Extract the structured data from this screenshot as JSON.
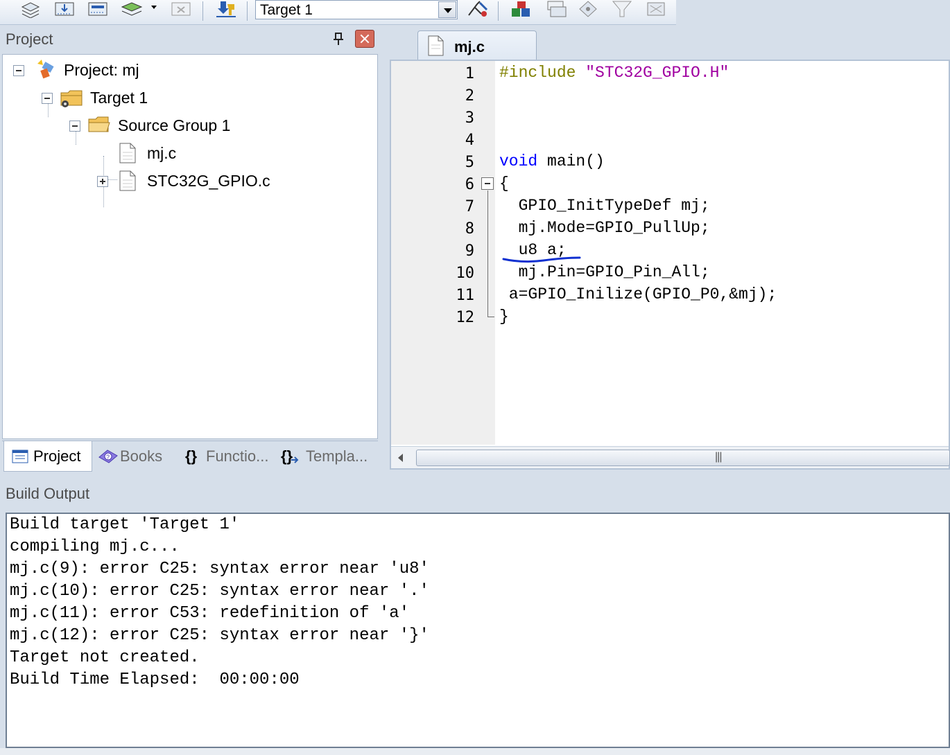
{
  "toolbar": {
    "target_select_value": "Target 1"
  },
  "project_panel": {
    "title": "Project",
    "tree": {
      "project": "Project: mj",
      "target": "Target 1",
      "group": "Source Group 1",
      "files": [
        "mj.c",
        "STC32G_GPIO.c"
      ]
    },
    "tabs": [
      "Project",
      "Books",
      "Functio...",
      "Templa..."
    ]
  },
  "editor": {
    "tab_label": "mj.c",
    "line_numbers": [
      "1",
      "2",
      "3",
      "4",
      "5",
      "6",
      "7",
      "8",
      "9",
      "10",
      "11",
      "12"
    ],
    "code": {
      "l1_directive": "#include",
      "l1_string": "\"STC32G_GPIO.H\"",
      "l5_keyword": "void",
      "l5_rest": " main()",
      "l6": "{",
      "l7": "  GPIO_InitTypeDef mj;",
      "l8": "  mj.Mode=GPIO_PullUp;",
      "l9": "  u8 a;",
      "l10": "  mj.Pin=GPIO_Pin_All;",
      "l11": " a=GPIO_Inilize(GPIO_P0,&mj);",
      "l12": "}"
    },
    "annotation_color": "#1030d0"
  },
  "build_output": {
    "title": "Build Output",
    "lines": [
      "Build target 'Target 1'",
      "compiling mj.c...",
      "mj.c(9): error C25: syntax error near 'u8'",
      "mj.c(10): error C25: syntax error near '.'",
      "mj.c(11): error C53: redefinition of 'a'",
      "mj.c(12): error C25: syntax error near '}'",
      "Target not created.",
      "Build Time Elapsed:  00:00:00"
    ]
  }
}
